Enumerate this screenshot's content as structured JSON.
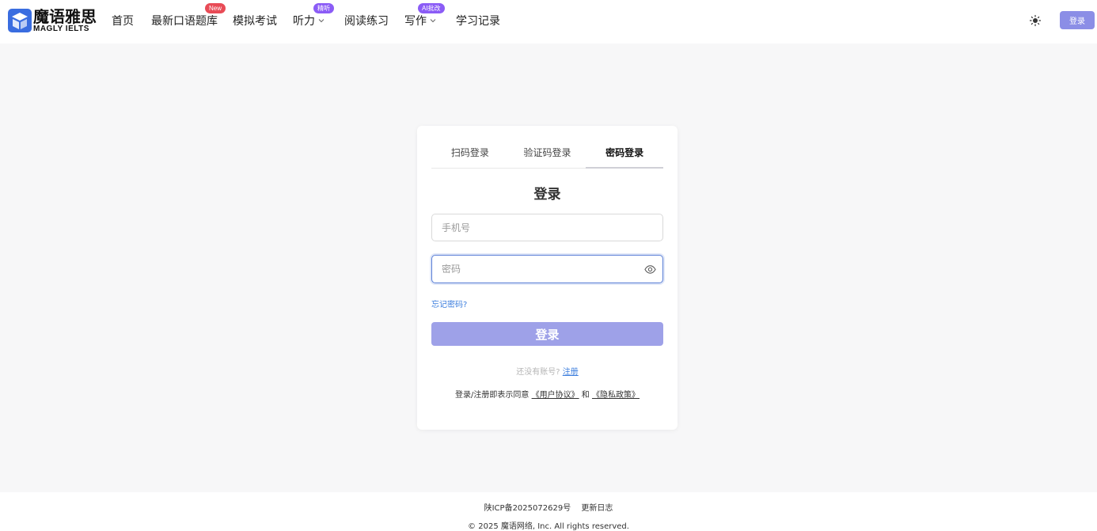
{
  "brand": {
    "name_cn": "魔语雅思",
    "name_en": "MAGLY IELTS"
  },
  "nav": {
    "items": [
      {
        "label": "首页"
      },
      {
        "label": "最新口语题库",
        "badge": "New"
      },
      {
        "label": "模拟考试"
      },
      {
        "label": "听力",
        "badge": "精听"
      },
      {
        "label": "阅读练习"
      },
      {
        "label": "写作",
        "badge": "AI批改"
      },
      {
        "label": "学习记录"
      }
    ],
    "login_label": "登录"
  },
  "login_card": {
    "tabs": [
      "扫码登录",
      "验证码登录",
      "密码登录"
    ],
    "active_tab": "密码登录",
    "title": "登录",
    "phone_placeholder": "手机号",
    "password_placeholder": "密码",
    "forgot_label": "忘记密码?",
    "submit_label": "登录",
    "no_account_text": "还没有账号?",
    "register_label": "注册",
    "agree_prefix": "登录/注册即表示同意",
    "user_agreement": "《用户协议》",
    "and_text": "和",
    "privacy_policy": "《隐私政策》"
  },
  "footer": {
    "icp": "陕ICP备2025072629号",
    "changelog": "更新日志",
    "copyright": "© 2025 魔语网络, Inc. All rights reserved."
  },
  "colors": {
    "accent": "#8b8ee6",
    "badge_new": "#e84b56",
    "badge_purple": "#8b5cf6",
    "link": "#3b7ddd"
  }
}
